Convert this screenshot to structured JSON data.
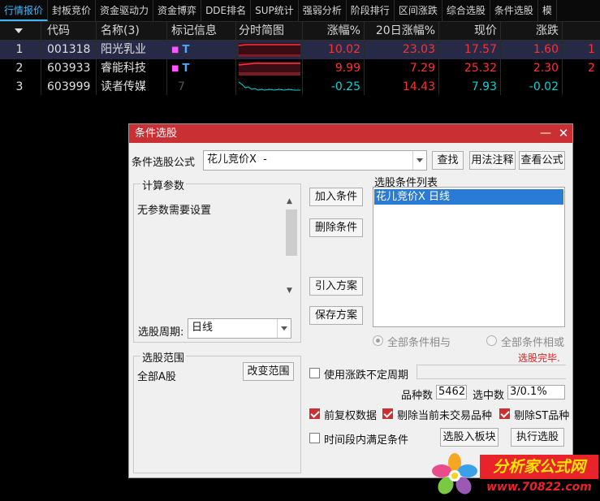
{
  "tabs": [
    "行情报价",
    "封板竞价",
    "资金驱动力",
    "资金博弈",
    "DDE排名",
    "SUP统计",
    "强弱分析",
    "阶段排行",
    "区间涨跌",
    "综合选股",
    "条件选股",
    "模"
  ],
  "table": {
    "headers": {
      "code": "代码",
      "name": "名称(3)",
      "mark": "标记信息",
      "spark": "分时简图",
      "pct": "涨幅%",
      "pct20": "20日涨幅%",
      "price": "现价",
      "chg": "涨跌"
    },
    "rows": [
      {
        "idx": "1",
        "code": "001318",
        "name": "阳光乳业",
        "mark": "T",
        "pct": "10.02",
        "pct20": "23.03",
        "price": "17.57",
        "chg": "1.60",
        "more": "1",
        "trend": "up"
      },
      {
        "idx": "2",
        "code": "603933",
        "name": "睿能科技",
        "mark": "T",
        "pct": "9.99",
        "pct20": "7.29",
        "price": "25.32",
        "chg": "2.30",
        "more": "2",
        "trend": "up"
      },
      {
        "idx": "3",
        "code": "603999",
        "name": "读者传媒",
        "mark": "7",
        "pct": "-0.25",
        "pct20": "14.43",
        "price": "7.93",
        "chg": "-0.02",
        "more": "",
        "trend": "down"
      }
    ]
  },
  "dialog": {
    "title": "条件选股",
    "formula_label": "条件选股公式",
    "formula_value": "花儿竞价X  -",
    "find_btn": "查找",
    "usage_btn": "用法注释",
    "view_btn": "查看公式",
    "params_legend": "计算参数",
    "params_text": "无参数需要设置",
    "period_label": "选股周期:",
    "period_value": "日线",
    "add_btn": "加入条件",
    "del_btn": "删除条件",
    "import_btn": "引入方案",
    "save_btn": "保存方案",
    "list_label": "选股条件列表",
    "list_items": [
      "花儿竞价X  日线"
    ],
    "radio_and": "全部条件相与",
    "radio_or": "全部条件相或",
    "status": "选股完毕.",
    "range_legend": "选股范围",
    "range_value": "全部A股",
    "change_range_btn": "改变范围",
    "use_period_label": "使用涨跌不定周期",
    "count_label": "品种数",
    "count_value": "5462",
    "selected_label": "选中数",
    "selected_value": "3/0.1%",
    "chk_fq": "前复权数据",
    "chk_untraded": "剔除当前未交易品种",
    "chk_st": "剔除ST品种",
    "chk_time": "时间段内满足条件",
    "to_block_btn": "选股入板块",
    "exec_btn": "执行选股"
  },
  "watermark": {
    "cn": "分析家公式网",
    "url": "www.70822.com"
  },
  "colors": {
    "up": "#ff3030",
    "down": "#00d8d8",
    "accent": "#c92f33",
    "tab_active": "#3fb7ff"
  }
}
